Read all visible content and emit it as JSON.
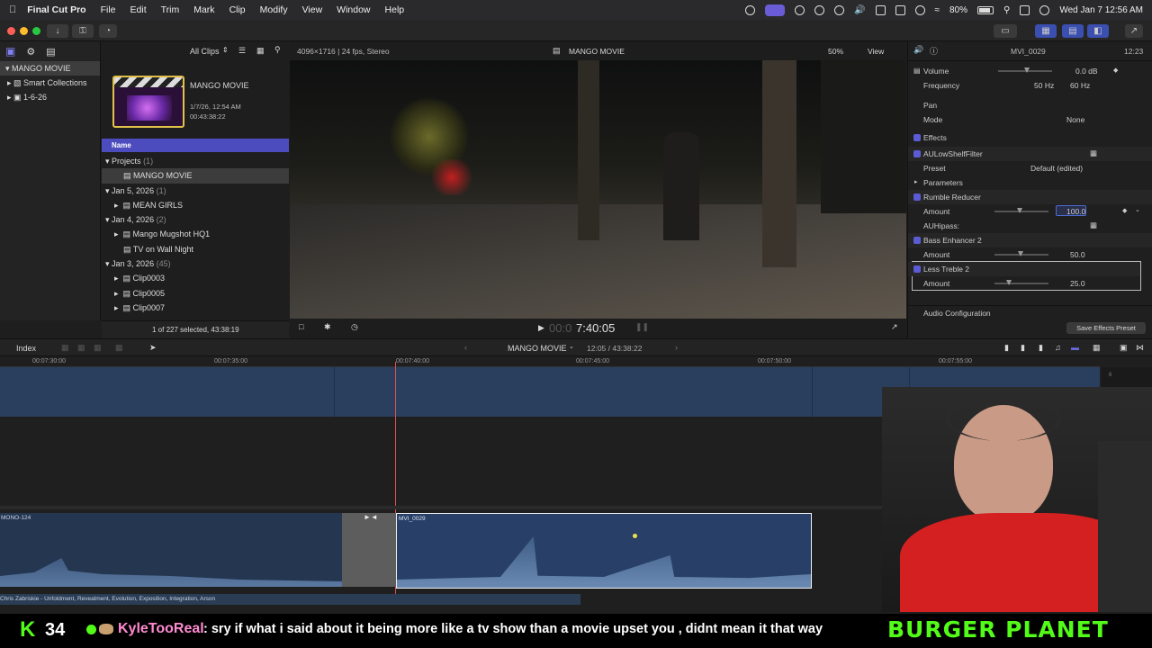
{
  "menubar": {
    "app": "Final Cut Pro",
    "items": [
      "File",
      "Edit",
      "Trim",
      "Mark",
      "Clip",
      "Modify",
      "View",
      "Window",
      "Help"
    ],
    "battery": "80%",
    "datetime": "Wed Jan 7  12:56 AM"
  },
  "libraries": {
    "items": [
      "MANGO MOVIE",
      "Smart Collections",
      "1-6-26"
    ]
  },
  "browser": {
    "filter": "All Clips",
    "project_title": "MANGO MOVIE",
    "project_date": "1/7/26, 12:54 AM",
    "project_duration": "00:43:38:22",
    "column_header": "Name",
    "rows": [
      {
        "label": "Projects",
        "count": "(1)",
        "type": "group"
      },
      {
        "label": "MANGO MOVIE",
        "type": "project"
      },
      {
        "label": "Jan 5, 2026",
        "count": "(1)",
        "type": "group"
      },
      {
        "label": "MEAN GIRLS",
        "type": "clip"
      },
      {
        "label": "Jan 4, 2026",
        "count": "(2)",
        "type": "group"
      },
      {
        "label": "Mango Mugshot HQ1",
        "type": "clip"
      },
      {
        "label": "TV on Wall Night",
        "type": "clip"
      },
      {
        "label": "Jan 3, 2026",
        "count": "(45)",
        "type": "group"
      },
      {
        "label": "Clip0003",
        "type": "clip"
      },
      {
        "label": "Clip0005",
        "type": "clip"
      },
      {
        "label": "Clip0007",
        "type": "clip"
      }
    ],
    "footer": "1 of 227 selected, 43:38:19"
  },
  "viewer": {
    "format": "4096×1716 | 24 fps, Stereo",
    "title": "MANGO MOVIE",
    "zoom": "50%",
    "view_menu": "View",
    "timecode_dim": "00:0",
    "timecode": "7:40:05"
  },
  "inspector": {
    "clip_name": "MVI_0029",
    "duration": "12:23",
    "rows": {
      "volume_label": "Volume",
      "volume_value": "0.0 dB",
      "frequency_label": "Frequency",
      "freq_a": "50 Hz",
      "freq_b": "60 Hz",
      "pan_label": "Pan",
      "mode_label": "Mode",
      "mode_value": "None",
      "effects_label": "Effects",
      "aulowshelf_label": "AULowShelfFilter",
      "preset_label": "Preset",
      "preset_value": "Default (edited)",
      "parameters_label": "Parameters",
      "rumble_label": "Rumble Reducer",
      "amount1_label": "Amount",
      "amount1_value": "100.0",
      "auhipass_label": "AUHipass:",
      "bass_label": "Bass Enhancer 2",
      "amount2_label": "Amount",
      "amount2_value": "50.0",
      "treble_label": "Less Treble 2",
      "amount3_label": "Amount",
      "amount3_value": "25.0",
      "audio_config_label": "Audio Configuration",
      "save_preset_label": "Save Effects Preset"
    }
  },
  "timeline": {
    "index_label": "Index",
    "project": "MANGO MOVIE",
    "position": "12:05 / 43:38:22",
    "ruler": [
      "00:07:30:00",
      "00:07:35:00",
      "00:07:40:00",
      "00:07:45:00",
      "00:07:50:00",
      "00:07:55:00"
    ],
    "meter_labels": [
      "6",
      "0",
      "-6"
    ],
    "clip_left": "MONO-124",
    "clip_main": "MVI_0029",
    "clip_right": "M",
    "music_track": "Chris Zabriskie - Unfoldment, Revealment, Evolution, Exposition, Integration, Arson"
  },
  "chat": {
    "logo": "K",
    "count": "34",
    "username": "KyleTooReal",
    "message": ": sry if what i said about it being more like a tv show than a movie upset you , didnt mean it that way",
    "sponsor": "BURGER PLANET"
  }
}
